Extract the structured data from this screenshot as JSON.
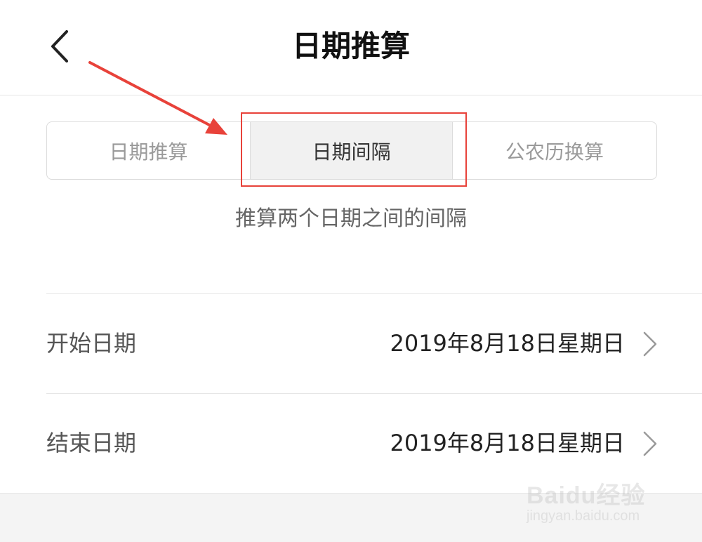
{
  "header": {
    "title": "日期推算",
    "back_icon": "chevron-left-icon"
  },
  "tabs": [
    {
      "label": "日期推算",
      "selected": false
    },
    {
      "label": "日期间隔",
      "selected": true
    },
    {
      "label": "公农历换算",
      "selected": false
    }
  ],
  "description": "推算两个日期之间的间隔",
  "rows": {
    "start": {
      "label": "开始日期",
      "value": "2019年8月18日星期日"
    },
    "end": {
      "label": "结束日期",
      "value": "2019年8月18日星期日"
    }
  },
  "watermark": {
    "brand": "Baidu经验",
    "url": "jingyan.baidu.com"
  },
  "colors": {
    "annotation": "#e8423a",
    "selected_tab_bg": "#f1f1f1",
    "divider": "#e6e6e6"
  }
}
